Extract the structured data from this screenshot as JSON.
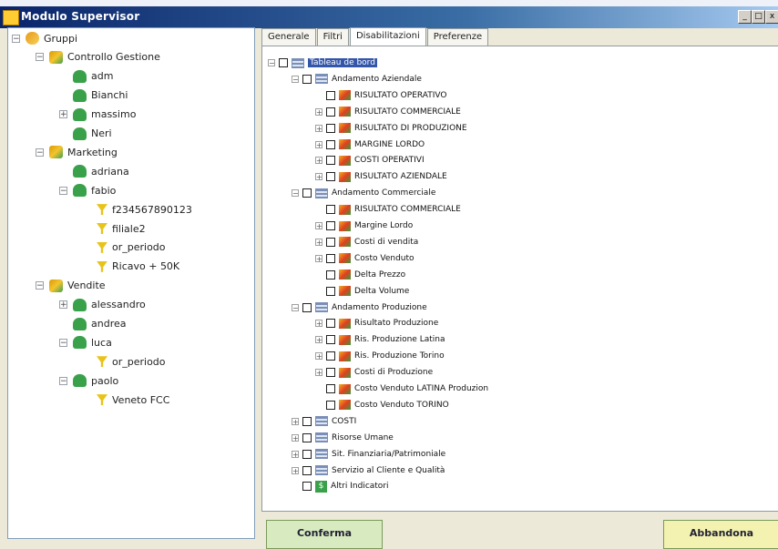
{
  "window": {
    "title": "Modulo Supervisor"
  },
  "title_buttons": {
    "minimize": "_",
    "maximize": "□",
    "close": "x"
  },
  "tree": [
    {
      "label": "Gruppi",
      "depth": 0,
      "icon": "root-icon",
      "expander": "−"
    },
    {
      "label": "Controllo Gestione",
      "depth": 1,
      "icon": "group-icon",
      "expander": "−"
    },
    {
      "label": "adm",
      "depth": 2,
      "icon": "user-icon",
      "expander": ""
    },
    {
      "label": "Bianchi",
      "depth": 2,
      "icon": "user-icon",
      "expander": ""
    },
    {
      "label": "massimo",
      "depth": 2,
      "icon": "user-icon",
      "expander": "+"
    },
    {
      "label": "Neri",
      "depth": 2,
      "icon": "user-icon",
      "expander": ""
    },
    {
      "label": "Marketing",
      "depth": 1,
      "icon": "group-icon",
      "expander": "−"
    },
    {
      "label": "adriana",
      "depth": 2,
      "icon": "user-icon",
      "expander": ""
    },
    {
      "label": "fabio",
      "depth": 2,
      "icon": "user-icon",
      "expander": "−"
    },
    {
      "label": "f234567890123",
      "depth": 3,
      "icon": "filter-icon",
      "expander": ""
    },
    {
      "label": "filiale2",
      "depth": 3,
      "icon": "filter-icon",
      "expander": ""
    },
    {
      "label": "or_periodo",
      "depth": 3,
      "icon": "filter-icon",
      "expander": ""
    },
    {
      "label": "Ricavo + 50K",
      "depth": 3,
      "icon": "filter-icon",
      "expander": ""
    },
    {
      "label": "Vendite",
      "depth": 1,
      "icon": "group-icon",
      "expander": "−"
    },
    {
      "label": "alessandro",
      "depth": 2,
      "icon": "user-icon",
      "expander": "+"
    },
    {
      "label": "andrea",
      "depth": 2,
      "icon": "user-icon",
      "expander": ""
    },
    {
      "label": "luca",
      "depth": 2,
      "icon": "user-icon",
      "expander": "−"
    },
    {
      "label": "or_periodo",
      "depth": 3,
      "icon": "filter-icon",
      "expander": ""
    },
    {
      "label": "paolo",
      "depth": 2,
      "icon": "user-icon",
      "expander": "−"
    },
    {
      "label": "Veneto FCC",
      "depth": 3,
      "icon": "filter-icon",
      "expander": ""
    }
  ],
  "tabs": [
    {
      "label": "Generale",
      "active": false
    },
    {
      "label": "Filtri",
      "active": false
    },
    {
      "label": "Disabilitazioni",
      "active": true
    },
    {
      "label": "Preferenze",
      "active": false
    }
  ],
  "checklist": [
    {
      "label": "Tableau de bord",
      "depth": 0,
      "icon": "grid-icon",
      "expander": "−",
      "highlight": true
    },
    {
      "label": "Andamento Aziendale",
      "depth": 1,
      "icon": "grid-icon",
      "expander": "−"
    },
    {
      "label": "RISULTATO OPERATIVO",
      "depth": 2,
      "icon": "chart-icon",
      "expander": ""
    },
    {
      "label": "RISULTATO COMMERCIALE",
      "depth": 2,
      "icon": "chart-icon",
      "expander": "+"
    },
    {
      "label": "RISULTATO DI PRODUZIONE",
      "depth": 2,
      "icon": "chart-icon",
      "expander": "+"
    },
    {
      "label": "MARGINE LORDO",
      "depth": 2,
      "icon": "chart-icon",
      "expander": "+"
    },
    {
      "label": "COSTI OPERATIVI",
      "depth": 2,
      "icon": "chart-icon",
      "expander": "+"
    },
    {
      "label": "RISULTATO AZIENDALE",
      "depth": 2,
      "icon": "chart-icon",
      "expander": "+"
    },
    {
      "label": "Andamento Commerciale",
      "depth": 1,
      "icon": "grid-icon",
      "expander": "−"
    },
    {
      "label": "RISULTATO COMMERCIALE",
      "depth": 2,
      "icon": "chart-icon",
      "expander": ""
    },
    {
      "label": "Margine Lordo",
      "depth": 2,
      "icon": "chart-icon",
      "expander": "+"
    },
    {
      "label": "Costi di vendita",
      "depth": 2,
      "icon": "chart-icon",
      "expander": "+"
    },
    {
      "label": "Costo Venduto",
      "depth": 2,
      "icon": "chart-icon",
      "expander": "+"
    },
    {
      "label": "Delta Prezzo",
      "depth": 2,
      "icon": "chart-icon",
      "expander": ""
    },
    {
      "label": "Delta Volume",
      "depth": 2,
      "icon": "chart-icon",
      "expander": ""
    },
    {
      "label": "Andamento Produzione",
      "depth": 1,
      "icon": "grid-icon",
      "expander": "−"
    },
    {
      "label": "Risultato Produzione",
      "depth": 2,
      "icon": "chart-icon",
      "expander": "+"
    },
    {
      "label": "Ris. Produzione Latina",
      "depth": 2,
      "icon": "chart-icon",
      "expander": "+"
    },
    {
      "label": "Ris. Produzione Torino",
      "depth": 2,
      "icon": "chart-icon",
      "expander": "+"
    },
    {
      "label": "Costi di Produzione",
      "depth": 2,
      "icon": "chart-icon",
      "expander": "+"
    },
    {
      "label": "Costo Venduto LATINA Produzion",
      "depth": 2,
      "icon": "chart-icon",
      "expander": ""
    },
    {
      "label": "Costo Venduto TORINO",
      "depth": 2,
      "icon": "chart-icon",
      "expander": ""
    },
    {
      "label": "COSTI",
      "depth": 1,
      "icon": "grid-icon",
      "expander": "+"
    },
    {
      "label": "Risorse Umane",
      "depth": 1,
      "icon": "grid-icon",
      "expander": "+"
    },
    {
      "label": "Sit. Finanziaria/Patrimoniale",
      "depth": 1,
      "icon": "grid-icon",
      "expander": "+"
    },
    {
      "label": "Servizio al Cliente e Qualità",
      "depth": 1,
      "icon": "grid-icon",
      "expander": "+"
    },
    {
      "label": "Altri Indicatori",
      "depth": 1,
      "icon": "dollar-icon",
      "expander": ""
    }
  ],
  "buttons": {
    "confirm": "Conferma",
    "cancel": "Abbandona"
  }
}
